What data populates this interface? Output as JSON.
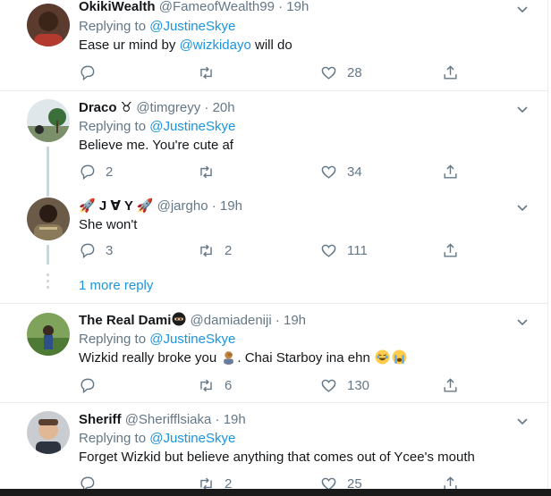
{
  "colors": {
    "link": "#1b95e0",
    "secondary": "#657786",
    "border": "#e6ecf0"
  },
  "tweets": [
    {
      "name": "OkikiWealth",
      "handle": "@FameofWealth99",
      "time": "19h",
      "replying_label": "Replying to",
      "replying_to": "@JustineSkye",
      "text_before": "Ease ur mind by ",
      "mention": "@wizkidayo",
      "text_after": " will do",
      "replies": "",
      "retweets": "",
      "likes": "28"
    },
    {
      "name": "Draco ♉",
      "handle": "@timgreyy",
      "time": "20h",
      "replying_label": "Replying to",
      "replying_to": "@JustineSkye",
      "text": "Believe me. You're cute af",
      "replies": "2",
      "retweets": "",
      "likes": "34"
    },
    {
      "name": "🚀 J ∀ Y 🚀",
      "handle": "@jargho",
      "time": "19h",
      "text": "She won't",
      "replies": "3",
      "retweets": "2",
      "likes": "111"
    },
    {
      "more_reply": "1 more reply"
    },
    {
      "name": "The Real Dami",
      "handle": "@damiadeniji",
      "time": "19h",
      "replying_label": "Replying to",
      "replying_to": "@JustineSkye",
      "text_before": "Wizkid really broke you ",
      "text_after": ". Chai Starboy ina ehn ",
      "replies": "",
      "retweets": "6",
      "likes": "130"
    },
    {
      "name": "Sheriff",
      "handle": "@Sherifflsiaka",
      "time": "19h",
      "replying_label": "Replying to",
      "replying_to": "@JustineSkye",
      "text": "Forget Wizkid but believe anything that comes out of Ycee's mouth",
      "replies": "",
      "retweets": "2",
      "likes": "25"
    }
  ],
  "icons": [
    "reply-icon",
    "retweet-icon",
    "like-icon",
    "share-icon",
    "caret-down-icon"
  ]
}
